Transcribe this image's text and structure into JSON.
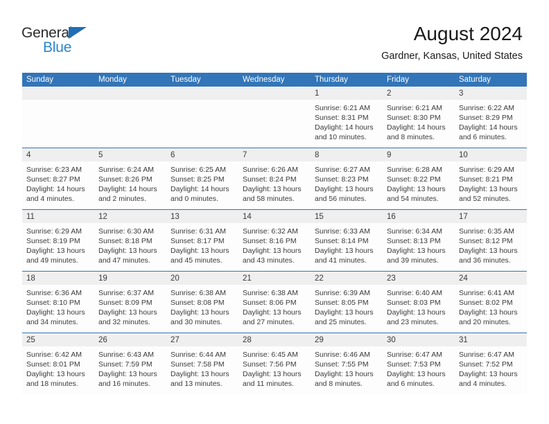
{
  "brand": {
    "name_top": "General",
    "name_bottom": "Blue",
    "triangle_color": "#1f6fb5",
    "blue_text_color": "#2b85d0"
  },
  "header": {
    "title": "August 2024",
    "subtitle": "Gardner, Kansas, United States"
  },
  "theme": {
    "header_blue": "#3275b8",
    "day_strip_gray": "#efefef",
    "cell_white": "#fdfdfd",
    "text_color": "#3a3a3a"
  },
  "weekdays": [
    "Sunday",
    "Monday",
    "Tuesday",
    "Wednesday",
    "Thursday",
    "Friday",
    "Saturday"
  ],
  "weeks": [
    {
      "days": [
        {
          "number": "",
          "lines": [
            "",
            "",
            "",
            ""
          ],
          "empty": true
        },
        {
          "number": "",
          "lines": [
            "",
            "",
            "",
            ""
          ],
          "empty": true
        },
        {
          "number": "",
          "lines": [
            "",
            "",
            "",
            ""
          ],
          "empty": true
        },
        {
          "number": "",
          "lines": [
            "",
            "",
            "",
            ""
          ],
          "empty": true
        },
        {
          "number": "1",
          "lines": [
            "Sunrise: 6:21 AM",
            "Sunset: 8:31 PM",
            "Daylight: 14 hours",
            "and 10 minutes."
          ],
          "empty": false
        },
        {
          "number": "2",
          "lines": [
            "Sunrise: 6:21 AM",
            "Sunset: 8:30 PM",
            "Daylight: 14 hours",
            "and 8 minutes."
          ],
          "empty": false
        },
        {
          "number": "3",
          "lines": [
            "Sunrise: 6:22 AM",
            "Sunset: 8:29 PM",
            "Daylight: 14 hours",
            "and 6 minutes."
          ],
          "empty": false
        }
      ]
    },
    {
      "days": [
        {
          "number": "4",
          "lines": [
            "Sunrise: 6:23 AM",
            "Sunset: 8:27 PM",
            "Daylight: 14 hours",
            "and 4 minutes."
          ],
          "empty": false
        },
        {
          "number": "5",
          "lines": [
            "Sunrise: 6:24 AM",
            "Sunset: 8:26 PM",
            "Daylight: 14 hours",
            "and 2 minutes."
          ],
          "empty": false
        },
        {
          "number": "6",
          "lines": [
            "Sunrise: 6:25 AM",
            "Sunset: 8:25 PM",
            "Daylight: 14 hours",
            "and 0 minutes."
          ],
          "empty": false
        },
        {
          "number": "7",
          "lines": [
            "Sunrise: 6:26 AM",
            "Sunset: 8:24 PM",
            "Daylight: 13 hours",
            "and 58 minutes."
          ],
          "empty": false
        },
        {
          "number": "8",
          "lines": [
            "Sunrise: 6:27 AM",
            "Sunset: 8:23 PM",
            "Daylight: 13 hours",
            "and 56 minutes."
          ],
          "empty": false
        },
        {
          "number": "9",
          "lines": [
            "Sunrise: 6:28 AM",
            "Sunset: 8:22 PM",
            "Daylight: 13 hours",
            "and 54 minutes."
          ],
          "empty": false
        },
        {
          "number": "10",
          "lines": [
            "Sunrise: 6:29 AM",
            "Sunset: 8:21 PM",
            "Daylight: 13 hours",
            "and 52 minutes."
          ],
          "empty": false
        }
      ]
    },
    {
      "days": [
        {
          "number": "11",
          "lines": [
            "Sunrise: 6:29 AM",
            "Sunset: 8:19 PM",
            "Daylight: 13 hours",
            "and 49 minutes."
          ],
          "empty": false
        },
        {
          "number": "12",
          "lines": [
            "Sunrise: 6:30 AM",
            "Sunset: 8:18 PM",
            "Daylight: 13 hours",
            "and 47 minutes."
          ],
          "empty": false
        },
        {
          "number": "13",
          "lines": [
            "Sunrise: 6:31 AM",
            "Sunset: 8:17 PM",
            "Daylight: 13 hours",
            "and 45 minutes."
          ],
          "empty": false
        },
        {
          "number": "14",
          "lines": [
            "Sunrise: 6:32 AM",
            "Sunset: 8:16 PM",
            "Daylight: 13 hours",
            "and 43 minutes."
          ],
          "empty": false
        },
        {
          "number": "15",
          "lines": [
            "Sunrise: 6:33 AM",
            "Sunset: 8:14 PM",
            "Daylight: 13 hours",
            "and 41 minutes."
          ],
          "empty": false
        },
        {
          "number": "16",
          "lines": [
            "Sunrise: 6:34 AM",
            "Sunset: 8:13 PM",
            "Daylight: 13 hours",
            "and 39 minutes."
          ],
          "empty": false
        },
        {
          "number": "17",
          "lines": [
            "Sunrise: 6:35 AM",
            "Sunset: 8:12 PM",
            "Daylight: 13 hours",
            "and 36 minutes."
          ],
          "empty": false
        }
      ]
    },
    {
      "days": [
        {
          "number": "18",
          "lines": [
            "Sunrise: 6:36 AM",
            "Sunset: 8:10 PM",
            "Daylight: 13 hours",
            "and 34 minutes."
          ],
          "empty": false
        },
        {
          "number": "19",
          "lines": [
            "Sunrise: 6:37 AM",
            "Sunset: 8:09 PM",
            "Daylight: 13 hours",
            "and 32 minutes."
          ],
          "empty": false
        },
        {
          "number": "20",
          "lines": [
            "Sunrise: 6:38 AM",
            "Sunset: 8:08 PM",
            "Daylight: 13 hours",
            "and 30 minutes."
          ],
          "empty": false
        },
        {
          "number": "21",
          "lines": [
            "Sunrise: 6:38 AM",
            "Sunset: 8:06 PM",
            "Daylight: 13 hours",
            "and 27 minutes."
          ],
          "empty": false
        },
        {
          "number": "22",
          "lines": [
            "Sunrise: 6:39 AM",
            "Sunset: 8:05 PM",
            "Daylight: 13 hours",
            "and 25 minutes."
          ],
          "empty": false
        },
        {
          "number": "23",
          "lines": [
            "Sunrise: 6:40 AM",
            "Sunset: 8:03 PM",
            "Daylight: 13 hours",
            "and 23 minutes."
          ],
          "empty": false
        },
        {
          "number": "24",
          "lines": [
            "Sunrise: 6:41 AM",
            "Sunset: 8:02 PM",
            "Daylight: 13 hours",
            "and 20 minutes."
          ],
          "empty": false
        }
      ]
    },
    {
      "days": [
        {
          "number": "25",
          "lines": [
            "Sunrise: 6:42 AM",
            "Sunset: 8:01 PM",
            "Daylight: 13 hours",
            "and 18 minutes."
          ],
          "empty": false
        },
        {
          "number": "26",
          "lines": [
            "Sunrise: 6:43 AM",
            "Sunset: 7:59 PM",
            "Daylight: 13 hours",
            "and 16 minutes."
          ],
          "empty": false
        },
        {
          "number": "27",
          "lines": [
            "Sunrise: 6:44 AM",
            "Sunset: 7:58 PM",
            "Daylight: 13 hours",
            "and 13 minutes."
          ],
          "empty": false
        },
        {
          "number": "28",
          "lines": [
            "Sunrise: 6:45 AM",
            "Sunset: 7:56 PM",
            "Daylight: 13 hours",
            "and 11 minutes."
          ],
          "empty": false
        },
        {
          "number": "29",
          "lines": [
            "Sunrise: 6:46 AM",
            "Sunset: 7:55 PM",
            "Daylight: 13 hours",
            "and 8 minutes."
          ],
          "empty": false
        },
        {
          "number": "30",
          "lines": [
            "Sunrise: 6:47 AM",
            "Sunset: 7:53 PM",
            "Daylight: 13 hours",
            "and 6 minutes."
          ],
          "empty": false
        },
        {
          "number": "31",
          "lines": [
            "Sunrise: 6:47 AM",
            "Sunset: 7:52 PM",
            "Daylight: 13 hours",
            "and 4 minutes."
          ],
          "empty": false
        }
      ]
    }
  ]
}
